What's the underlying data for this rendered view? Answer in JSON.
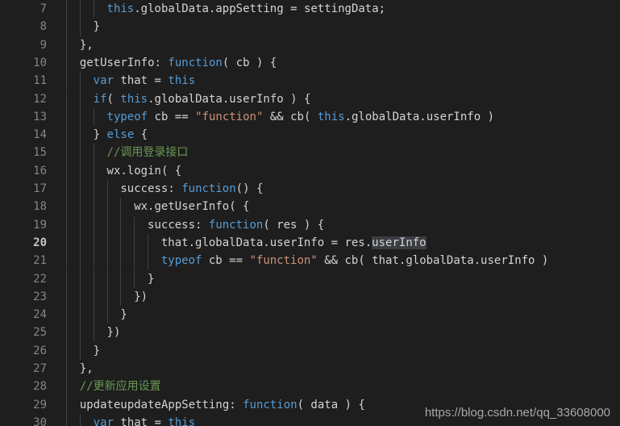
{
  "editor": {
    "theme": "vscode-dark",
    "background": "#1e1e1e",
    "gutter_color": "#858585",
    "active_line": 20,
    "first_line": 7,
    "last_line": 30,
    "colors": {
      "keyword": "#569cd6",
      "string": "#ce9178",
      "comment": "#6a9955",
      "identifier": "#d4d4d4",
      "selection": "#3a3d41",
      "indent_guide": "#404040",
      "active_line_number": "#c6c6c6"
    },
    "lines": [
      {
        "num": "7",
        "indent": 3,
        "tokens": [
          {
            "t": "key",
            "s": "this"
          },
          {
            "t": "id",
            "s": ".globalData.appSetting = settingData;"
          }
        ]
      },
      {
        "num": "8",
        "indent": 2,
        "tokens": [
          {
            "t": "id",
            "s": "}"
          }
        ]
      },
      {
        "num": "9",
        "indent": 1,
        "tokens": [
          {
            "t": "id",
            "s": "},"
          }
        ]
      },
      {
        "num": "10",
        "indent": 1,
        "tokens": [
          {
            "t": "id",
            "s": "getUserInfo: "
          },
          {
            "t": "key",
            "s": "function"
          },
          {
            "t": "id",
            "s": "( cb ) {"
          }
        ]
      },
      {
        "num": "11",
        "indent": 2,
        "tokens": [
          {
            "t": "key",
            "s": "var"
          },
          {
            "t": "id",
            "s": " that = "
          },
          {
            "t": "key",
            "s": "this"
          }
        ]
      },
      {
        "num": "12",
        "indent": 2,
        "tokens": [
          {
            "t": "key",
            "s": "if"
          },
          {
            "t": "id",
            "s": "( "
          },
          {
            "t": "key",
            "s": "this"
          },
          {
            "t": "id",
            "s": ".globalData.userInfo ) {"
          }
        ]
      },
      {
        "num": "13",
        "indent": 3,
        "tokens": [
          {
            "t": "key",
            "s": "typeof"
          },
          {
            "t": "id",
            "s": " cb == "
          },
          {
            "t": "str",
            "s": "\"function\""
          },
          {
            "t": "id",
            "s": " && cb( "
          },
          {
            "t": "key",
            "s": "this"
          },
          {
            "t": "id",
            "s": ".globalData.userInfo )"
          }
        ]
      },
      {
        "num": "14",
        "indent": 2,
        "tokens": [
          {
            "t": "id",
            "s": "} "
          },
          {
            "t": "key",
            "s": "else"
          },
          {
            "t": "id",
            "s": " {"
          }
        ]
      },
      {
        "num": "15",
        "indent": 3,
        "tokens": [
          {
            "t": "com",
            "s": "//调用登录接口"
          }
        ]
      },
      {
        "num": "16",
        "indent": 3,
        "tokens": [
          {
            "t": "id",
            "s": "wx.login( {"
          }
        ]
      },
      {
        "num": "17",
        "indent": 4,
        "tokens": [
          {
            "t": "id",
            "s": "success: "
          },
          {
            "t": "key",
            "s": "function"
          },
          {
            "t": "id",
            "s": "() {"
          }
        ]
      },
      {
        "num": "18",
        "indent": 5,
        "tokens": [
          {
            "t": "id",
            "s": "wx.getUserInfo( {"
          }
        ]
      },
      {
        "num": "19",
        "indent": 6,
        "tokens": [
          {
            "t": "id",
            "s": "success: "
          },
          {
            "t": "key",
            "s": "function"
          },
          {
            "t": "id",
            "s": "( res ) {"
          }
        ]
      },
      {
        "num": "20",
        "indent": 7,
        "active": true,
        "tokens": [
          {
            "t": "id",
            "s": "that.globalData.userInfo = res."
          },
          {
            "t": "sel",
            "s": "userInfo"
          }
        ]
      },
      {
        "num": "21",
        "indent": 7,
        "tokens": [
          {
            "t": "key",
            "s": "typeof"
          },
          {
            "t": "id",
            "s": " cb == "
          },
          {
            "t": "str",
            "s": "\"function\""
          },
          {
            "t": "id",
            "s": " && cb( that.globalData.userInfo )"
          }
        ]
      },
      {
        "num": "22",
        "indent": 6,
        "tokens": [
          {
            "t": "id",
            "s": "}"
          }
        ]
      },
      {
        "num": "23",
        "indent": 5,
        "tokens": [
          {
            "t": "id",
            "s": "})"
          }
        ]
      },
      {
        "num": "24",
        "indent": 4,
        "tokens": [
          {
            "t": "id",
            "s": "}"
          }
        ]
      },
      {
        "num": "25",
        "indent": 3,
        "tokens": [
          {
            "t": "id",
            "s": "})"
          }
        ]
      },
      {
        "num": "26",
        "indent": 2,
        "tokens": [
          {
            "t": "id",
            "s": "}"
          }
        ]
      },
      {
        "num": "27",
        "indent": 1,
        "tokens": [
          {
            "t": "id",
            "s": "},"
          }
        ]
      },
      {
        "num": "28",
        "indent": 1,
        "tokens": [
          {
            "t": "com",
            "s": "//更新应用设置"
          }
        ]
      },
      {
        "num": "29",
        "indent": 1,
        "tokens": [
          {
            "t": "id",
            "s": "updateupdateAppSetting: "
          },
          {
            "t": "key",
            "s": "function"
          },
          {
            "t": "id",
            "s": "( data ) {"
          }
        ]
      },
      {
        "num": "30",
        "indent": 2,
        "partial": true,
        "tokens": [
          {
            "t": "key",
            "s": "var"
          },
          {
            "t": "id",
            "s": " that = "
          },
          {
            "t": "key",
            "s": "this"
          }
        ]
      }
    ]
  },
  "watermark": {
    "text": "https://blog.csdn.net/qq_33608000"
  }
}
